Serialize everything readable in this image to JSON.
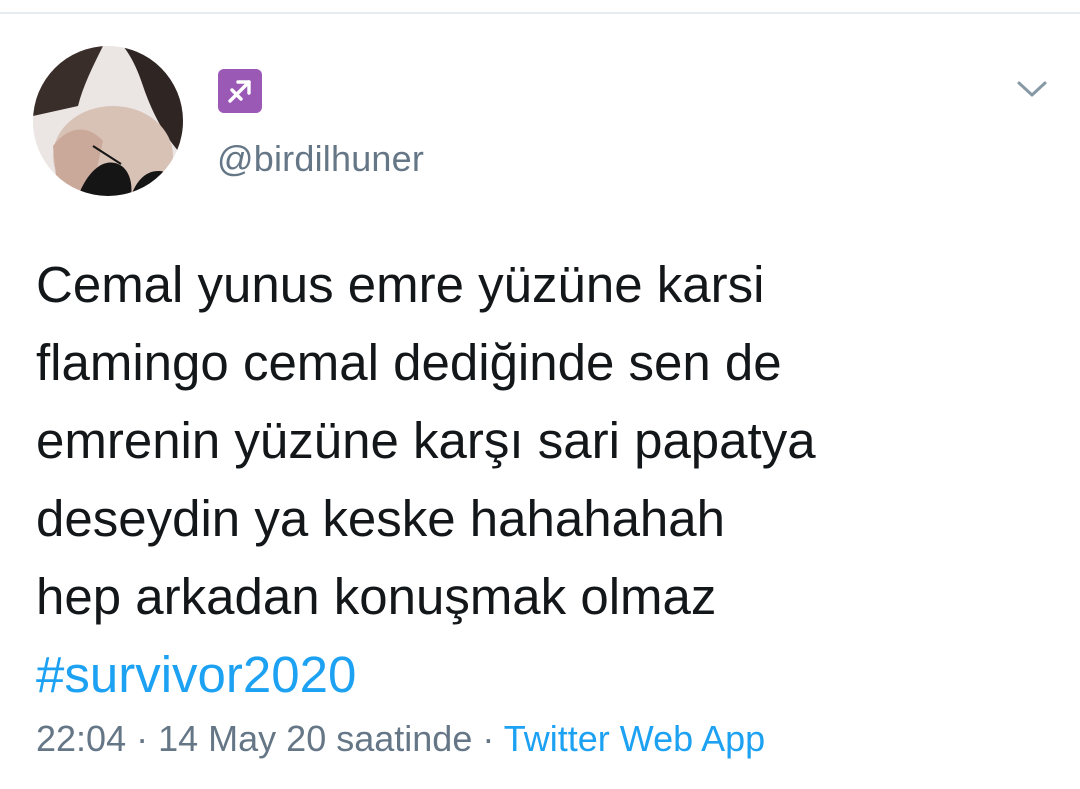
{
  "tweet": {
    "display_name_icon": "sagittarius-icon",
    "handle": "@birdilhuner",
    "text_lines": [
      "Cemal yunus emre yüzüne karsi",
      "flamingo cemal dediğinde sen de",
      "emrenin yüzüne karşı sari papatya",
      "deseydin ya keske hahahahah",
      "hep arkadan konuşmak olmaz"
    ],
    "hashtag": "#survivor2020",
    "time": "22:04",
    "separator": "·",
    "date": "14 May 20 saatinde",
    "source": "Twitter Web App"
  },
  "colors": {
    "link": "#1da1f2",
    "secondary_text": "#657786",
    "primary_text": "#14171a",
    "sagittarius_badge": "#9b59b6"
  }
}
